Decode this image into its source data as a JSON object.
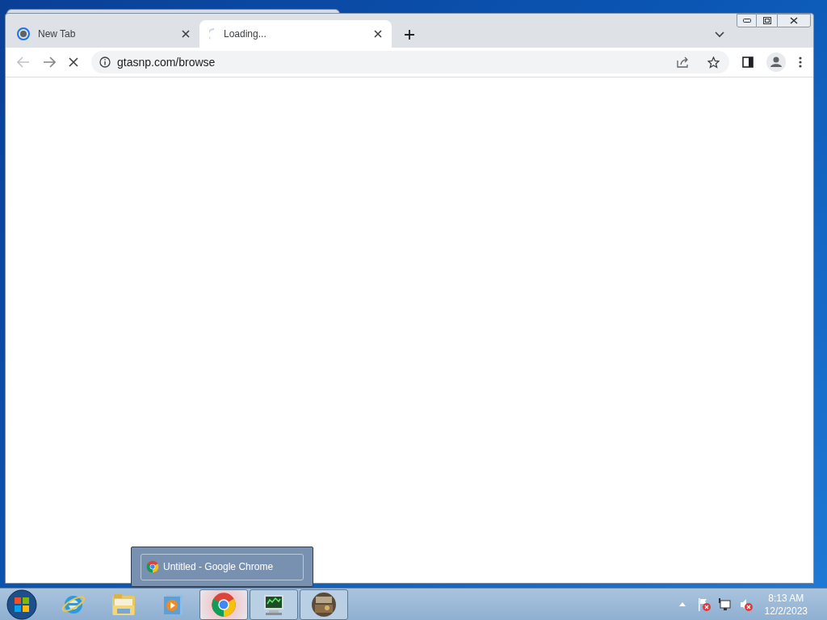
{
  "browser": {
    "tabs": [
      {
        "title": "New Tab",
        "kind": "newtab",
        "selected": false
      },
      {
        "title": "Loading...",
        "kind": "loading",
        "selected": true
      }
    ],
    "address": {
      "url": "gtasnp.com/browse"
    }
  },
  "tooltip": {
    "title": "Untitled - Google Chrome"
  },
  "taskbar": {
    "items": [
      {
        "kind": "ie",
        "running": false,
        "selected": false
      },
      {
        "kind": "explorer",
        "running": false,
        "selected": false
      },
      {
        "kind": "media",
        "running": false,
        "selected": false
      },
      {
        "kind": "chrome",
        "running": true,
        "selected": true
      },
      {
        "kind": "monitor",
        "running": true,
        "selected": false
      },
      {
        "kind": "game",
        "running": true,
        "selected": false
      }
    ],
    "clock": {
      "time": "8:13 AM",
      "date": "12/2/2023"
    }
  }
}
